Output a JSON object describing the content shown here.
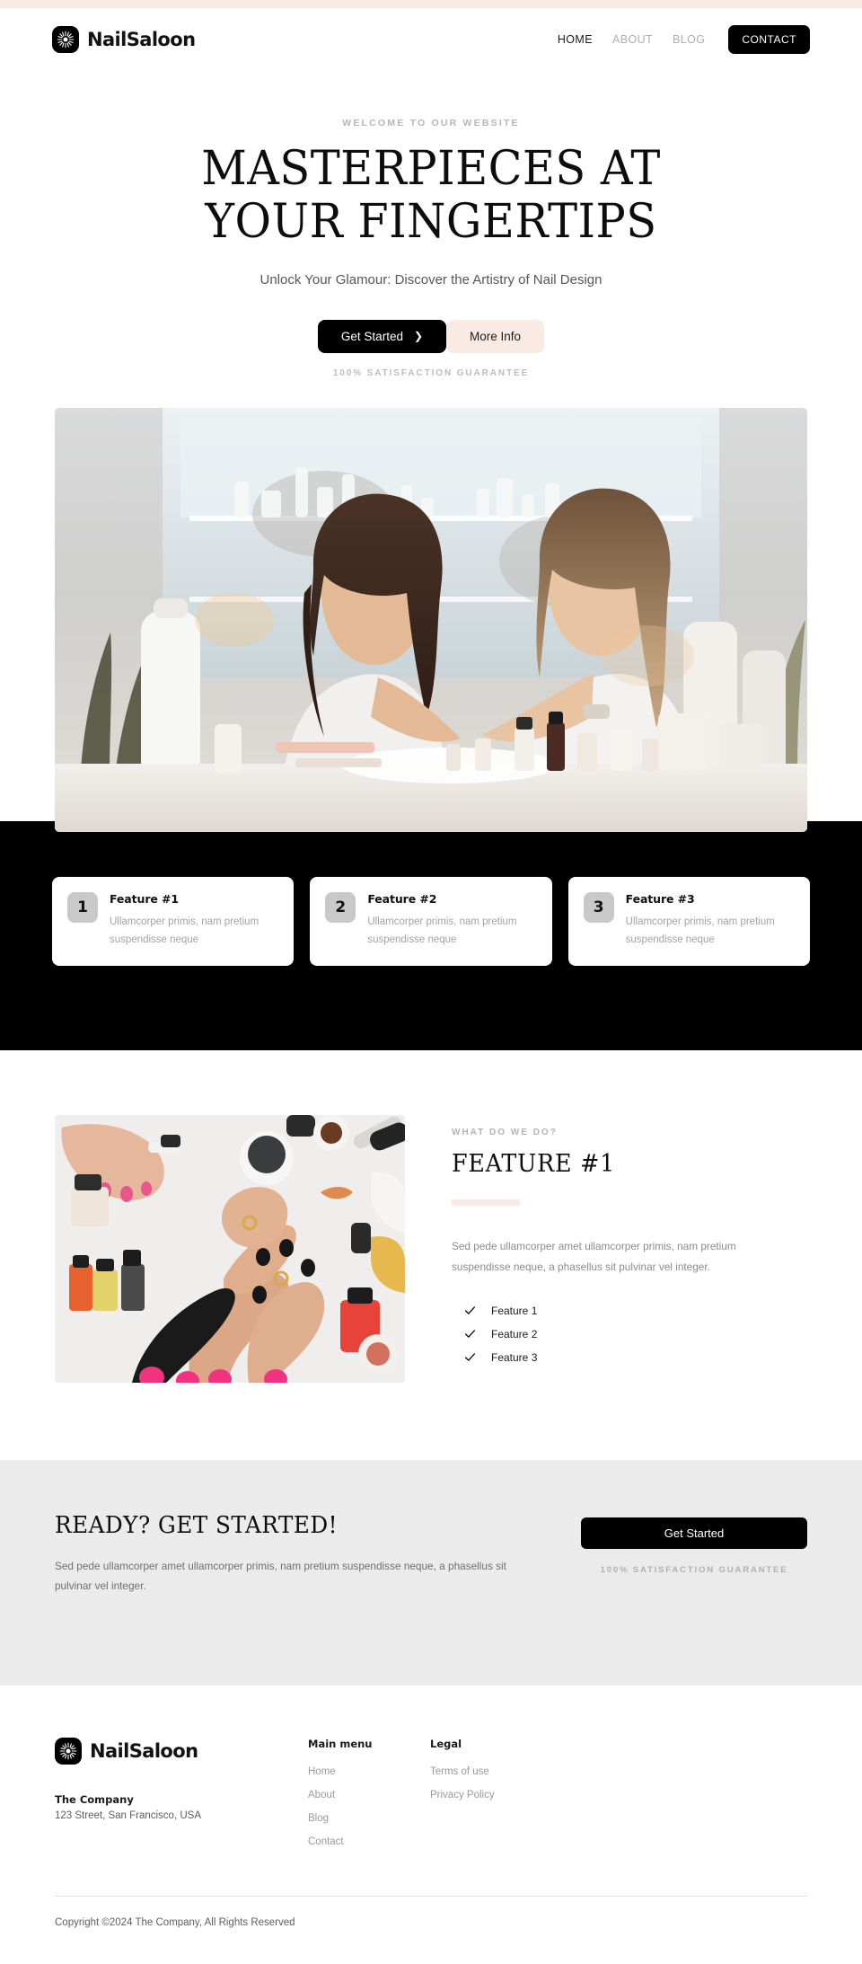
{
  "header": {
    "brand": "NailSaloon",
    "logo_icon": "sunburst-icon",
    "nav": [
      {
        "label": "HOME",
        "active": true
      },
      {
        "label": "ABOUT",
        "active": false
      },
      {
        "label": "BLOG",
        "active": false
      }
    ],
    "cta_label": "CONTACT"
  },
  "hero": {
    "eyebrow": "WELCOME TO OUR WEBSITE",
    "title_line1": "MASTERPIECES AT",
    "title_line2": "YOUR FINGERTIPS",
    "subtitle": "Unlock Your Glamour: Discover the Artistry of Nail Design",
    "primary_btn": "Get Started",
    "primary_btn_icon": "chevron-right-icon",
    "secondary_btn": "More Info",
    "guarantee": "100% SATISFACTION GUARANTEE",
    "image_alt": "Two women at a nail salon, one doing the other's manicure"
  },
  "features_band": {
    "cards": [
      {
        "number": "1",
        "title": "Feature #1",
        "description": "Ullamcorper primis, nam pretium suspendisse neque"
      },
      {
        "number": "2",
        "title": "Feature #2",
        "description": "Ullamcorper primis, nam pretium suspendisse neque"
      },
      {
        "number": "3",
        "title": "Feature #3",
        "description": "Ullamcorper primis, nam pretium suspendisse neque"
      }
    ]
  },
  "feature_section": {
    "eyebrow": "WHAT DO WE DO?",
    "title": "FEATURE #1",
    "body": "Sed pede ullamcorper amet ullamcorper primis, nam pretium suspendisse neque, a phasellus sit pulvinar vel integer.",
    "list": [
      "Feature 1",
      "Feature 2",
      "Feature 3"
    ],
    "image_alt": "Flat lay of hands with manicure and nail polish bottles"
  },
  "cta": {
    "title": "READY? GET STARTED!",
    "text": "Sed pede ullamcorper amet ullamcorper primis, nam pretium suspendisse neque, a phasellus sit pulvinar vel integer.",
    "button": "Get Started",
    "guarantee": "100% SATISFACTION GUARANTEE"
  },
  "footer": {
    "brand": "NailSaloon",
    "company": "The Company",
    "address": "123 Street, San Francisco, USA",
    "menu_title": "Main menu",
    "menu": [
      "Home",
      "About",
      "Blog",
      "Contact"
    ],
    "legal_title": "Legal",
    "legal": [
      "Terms of use",
      "Privacy Policy"
    ],
    "copyright": "Copyright ©2024 The Company, All Rights Reserved"
  },
  "colors": {
    "accent_pink": "#faeae4",
    "black": "#000000",
    "gray_band": "#ebebeb",
    "muted_text": "#9a9a9a"
  }
}
